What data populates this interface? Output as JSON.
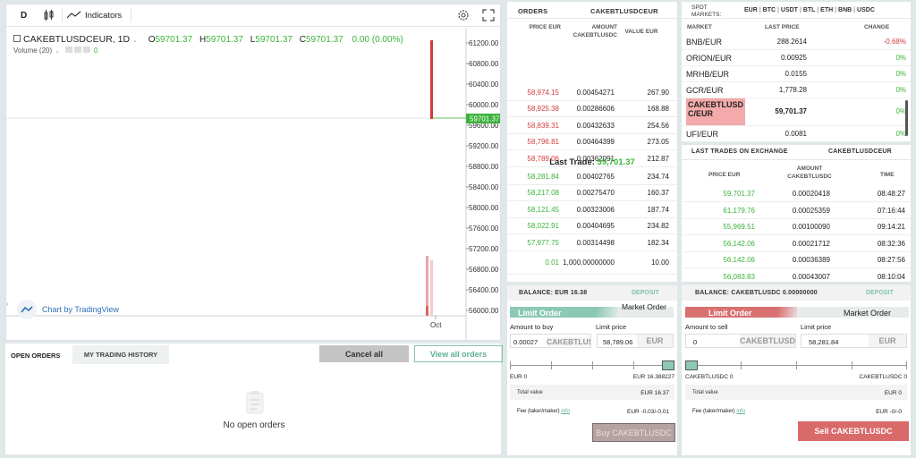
{
  "chart": {
    "toolbar": {
      "interval": "D",
      "indicators_label": "Indicators"
    },
    "legend": {
      "symbol": "CAKEBTLUSDCEUR, 1D",
      "o_label": "O",
      "o_value": "59701.37",
      "h_label": "H",
      "h_value": "59701.37",
      "l_label": "L",
      "l_value": "59701.37",
      "c_label": "C",
      "c_value": "59701.37",
      "change": "0.00 (0.00%)",
      "volume_label": "Volume (20)",
      "volume_value": "0"
    },
    "price_axis": [
      "61200.00",
      "60800.00",
      "60400.00",
      "60000.00",
      "59600.00",
      "59200.00",
      "58800.00",
      "58400.00",
      "58000.00",
      "57600.00",
      "57200.00",
      "56800.00",
      "56400.00",
      "56000.00"
    ],
    "last_price_tag": "59701.37",
    "time_axis": [
      "Oct"
    ],
    "attribution": "Chart by TradingView"
  },
  "orders_tabs": {
    "open_orders": "OPEN ORDERS",
    "trading_history": "MY TRADING HISTORY",
    "cancel_all": "Cancel all",
    "view_all": "View all orders",
    "empty": "No open orders"
  },
  "orderbook": {
    "title": "ORDERS",
    "pair": "CAKEBTLUSDCEUR",
    "col_price": "PRICE EUR",
    "col_amount": "AMOUNT CAKEBTLUSDC",
    "col_value": "VALUE EUR",
    "asks": [
      {
        "price": "58,974.15",
        "amount": "0.00454271",
        "value": "267.90"
      },
      {
        "price": "58,925.38",
        "amount": "0.00286606",
        "value": "168.88"
      },
      {
        "price": "58,839.31",
        "amount": "0.00432633",
        "value": "254.56"
      },
      {
        "price": "58,796.81",
        "amount": "0.00464399",
        "value": "273.05"
      },
      {
        "price": "58,789.06",
        "amount": "0.00362091",
        "value": "212.87"
      }
    ],
    "last_trade_label": "Last Trade:",
    "last_trade_value": "59,701.37",
    "bids": [
      {
        "price": "58,281.84",
        "amount": "0.00402765",
        "value": "234.74"
      },
      {
        "price": "58,217.08",
        "amount": "0.00275470",
        "value": "160.37"
      },
      {
        "price": "58,121.45",
        "amount": "0.00323006",
        "value": "187.74"
      },
      {
        "price": "58,022.91",
        "amount": "0.00404695",
        "value": "234.82"
      },
      {
        "price": "57,977.75",
        "amount": "0.00314498",
        "value": "182.34"
      },
      {
        "price": "0.01",
        "amount": "1,000.00000000",
        "value": "10.00"
      }
    ]
  },
  "markets": {
    "title": "SPOT MARKETS:",
    "filters": [
      "EUR",
      "BTC",
      "USDT",
      "BTL",
      "ETH",
      "BNB",
      "USDC"
    ],
    "col_market": "MARKET",
    "col_last": "LAST PRICE",
    "col_change": "CHANGE",
    "rows": [
      {
        "market": "BNB/EUR",
        "last": "288.2614",
        "change": "-0.68%",
        "neg": true
      },
      {
        "market": "ORION/EUR",
        "last": "0.00925",
        "change": "0%",
        "neg": false
      },
      {
        "market": "MRHB/EUR",
        "last": "0.0155",
        "change": "0%",
        "neg": false
      },
      {
        "market": "GCR/EUR",
        "last": "1,778.28",
        "change": "0%",
        "neg": false
      },
      {
        "market": "CAKEBTLUSDC/EUR",
        "last": "59,701.37",
        "change": "0%",
        "neg": false
      },
      {
        "market": "UFI/EUR",
        "last": "0.0081",
        "change": "0%",
        "neg": false
      }
    ]
  },
  "last_trades": {
    "title": "LAST TRADES ON EXCHANGE",
    "pair": "CAKEBTLUSDCEUR",
    "col_price": "PRICE EUR",
    "col_amount": "AMOUNT CAKEBTLUSDC",
    "col_time": "TIME",
    "rows": [
      {
        "price": "59,701.37",
        "amount": "0.00020418",
        "time": "08:48:27"
      },
      {
        "price": "61,179.76",
        "amount": "0.00025359",
        "time": "07:16:44"
      },
      {
        "price": "55,969.51",
        "amount": "0.00100090",
        "time": "09:14:21"
      },
      {
        "price": "56,142.06",
        "amount": "0.00021712",
        "time": "08:32:36"
      },
      {
        "price": "56,142.06",
        "amount": "0.00036389",
        "time": "08:27:56"
      },
      {
        "price": "56,083.83",
        "amount": "0.00043007",
        "time": "08:10:04"
      }
    ]
  },
  "buy": {
    "balance_label": "BALANCE: EUR 16.38",
    "deposit": "DEPOSIT",
    "tab_limit": "Limit Order",
    "tab_market": "Market Order",
    "amount_label": "Amount to buy",
    "amount_value": "0.00027",
    "amount_unit": "CAKEBTLUSDC",
    "price_label": "Limit price",
    "price_value": "58,789.06",
    "price_unit": "EUR",
    "slider_min": "EUR 0",
    "slider_max": "EUR 16.388227",
    "total_label": "Total value",
    "total_value": "EUR 16.37",
    "fee_label": "Fee (taker/maker)",
    "fee_info": "info",
    "fee_value": "EUR -0.03/-0.01",
    "button": "Buy CAKEBTLUSDC"
  },
  "sell": {
    "balance_label": "BALANCE: CAKEBTLUSDC 0.00000000",
    "deposit": "DEPOSIT",
    "tab_limit": "Limit Order",
    "tab_market": "Market Order",
    "amount_label": "Amount to sell",
    "amount_value": "0",
    "amount_unit": "CAKEBTLUSDC",
    "price_label": "Limit price",
    "price_value": "58,281.84",
    "price_unit": "EUR",
    "slider_min": "CAKEBTLUSDC 0",
    "slider_max": "CAKEBTLUSDC 0",
    "total_label": "Total value",
    "total_value": "EUR 0",
    "fee_label": "Fee (taker/maker)",
    "fee_info": "info",
    "fee_value": "EUR -0/-0",
    "button": "Sell CAKEBTLUSDC"
  },
  "colors": {
    "green": "#3bb33b",
    "red": "#d33a3a",
    "accent": "#7fc3b0",
    "sell_accent": "#d97070"
  }
}
